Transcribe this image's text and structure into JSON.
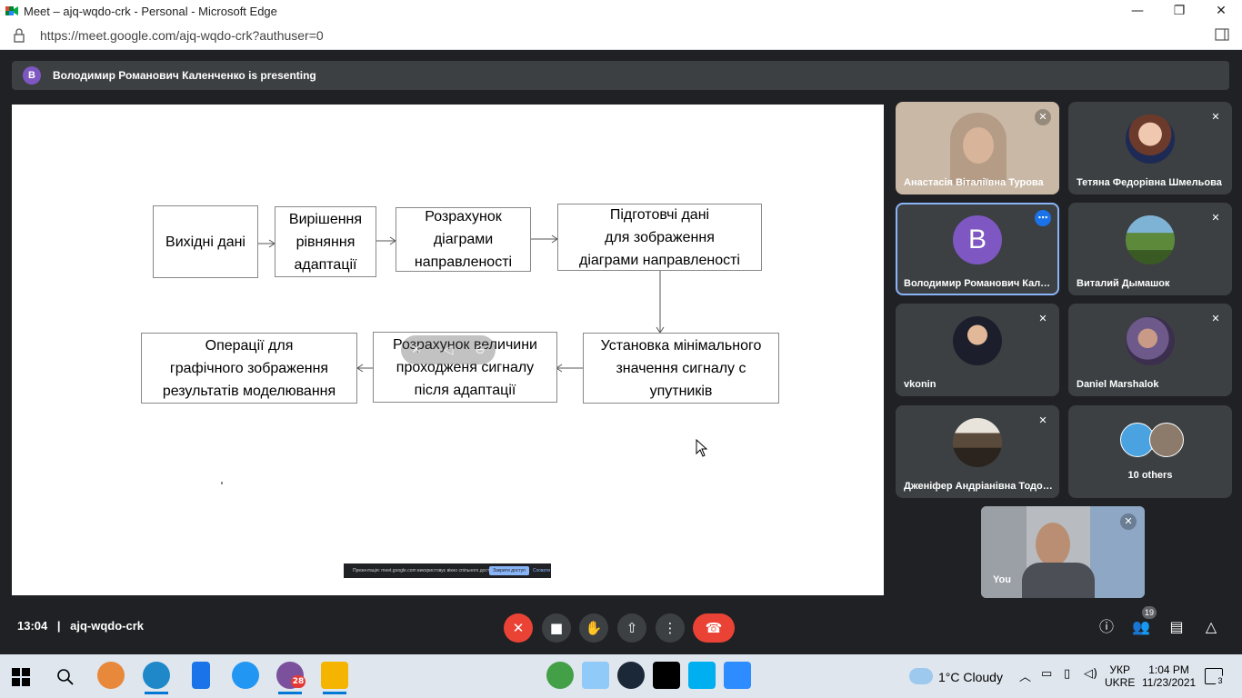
{
  "browser": {
    "title": "Meet – ajq-wqdo-crk - Personal - Microsoft Edge",
    "url": "https://meet.google.com/ajq-wqdo-crk?authuser=0",
    "controls": {
      "minimize": "—",
      "restore": "❐",
      "close": "✕"
    }
  },
  "banner": {
    "avatar_letter": "В",
    "text": "Володимир Романович Каленченко is presenting"
  },
  "slide": {
    "boxes": [
      "Вихідні дані",
      "Вирішення\nрівняння\nадаптації",
      "Розрахунок\nдіаграми\nнаправленості",
      "Підготовчі дані\nдля зображення\nдіаграми направленості",
      "Установка мінімального\nзначення сигналу с\nупутників",
      "Розрахунок величини\nпроходженя сигналу\nпісля адаптації",
      "Операції для\nграфічного зображення\nрезультатів моделювання"
    ],
    "share_bar": {
      "message": "Презентація: meet.google.com використовує вікно спільного доступу",
      "stop_label": "Закрити доступ",
      "hide_label": "Сховати"
    }
  },
  "participants": [
    {
      "name": "Анастасія Віталіївна Турова",
      "muted": true
    },
    {
      "name": "Тетяна Федорівна Шмельова",
      "muted": true
    },
    {
      "name": "Володимир Романович Каленченко",
      "avatar_letter": "В",
      "active": true
    },
    {
      "name": "Виталий Дымашок",
      "muted": true
    },
    {
      "name": "vkonin",
      "muted": true
    },
    {
      "name": "Daniel Marshalok",
      "muted": true
    },
    {
      "name": "Дженіфер Андріанівна Тодорова",
      "muted": true
    },
    {
      "name": "10 others"
    },
    {
      "name": "You",
      "muted": true
    }
  ],
  "meeting": {
    "time": "13:04",
    "separator": "|",
    "code": "ajq-wqdo-crk",
    "people_count": "19"
  },
  "taskbar": {
    "weather": "1°C  Cloudy",
    "lang_top": "УКР",
    "lang_bottom": "UKRE",
    "time": "1:04 PM",
    "date": "11/23/2021",
    "viber_badge": "28",
    "notif_count": "3"
  },
  "colors": {
    "meet_bg": "#202124",
    "tile_bg": "#3c4043",
    "hangup": "#ea4335",
    "active_border": "#8ab4f8",
    "avatar_purple": "#7e57c2"
  }
}
